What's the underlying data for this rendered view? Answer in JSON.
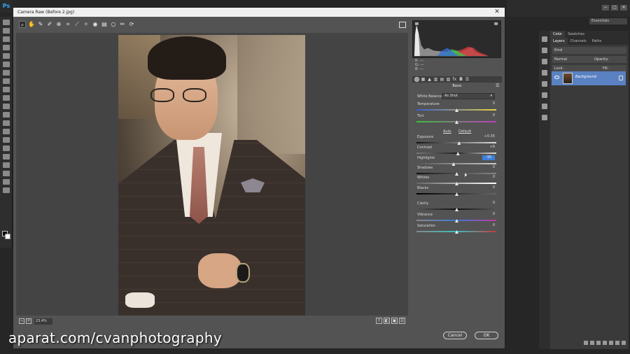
{
  "app": {
    "logo": "Ps",
    "workspace": "Essentials",
    "window_buttons": [
      "−",
      "▢",
      "✕"
    ]
  },
  "dialog": {
    "title": "Camera Raw (Before 2.jpg)",
    "close": "✕"
  },
  "tools": [
    "zoom-icon",
    "hand-icon",
    "white-balance-icon",
    "color-sampler-icon",
    "target-adjust-icon",
    "crop-icon",
    "straighten-icon",
    "spot-removal-icon",
    "red-eye-icon",
    "graduated-filter-icon",
    "radial-filter-icon",
    "brush-icon",
    "rotate-icon"
  ],
  "tool_glyphs": [
    "⌕",
    "✋",
    "✎",
    "✐",
    "⊕",
    "⌗",
    "⟋",
    "✧",
    "◉",
    "▤",
    "○",
    "✏",
    "⟳"
  ],
  "canvas": {
    "zoom": "23.4%",
    "zoom_minus": "−",
    "zoom_plus": "+",
    "view_buttons": [
      "Y",
      "◧",
      "▣",
      "☰"
    ]
  },
  "readout": {
    "r": "R:  ---",
    "g": "G:  ---",
    "b": "B:  ---"
  },
  "panel": {
    "name": "Basic",
    "tab_glyphs": [
      "◎",
      "▦",
      "▲",
      "▥",
      "▤",
      "▧",
      "fx",
      "◘",
      "☰"
    ],
    "white_balance_label": "White Balance:",
    "white_balance_value": "As Shot",
    "auto": "Auto",
    "default": "Default",
    "sliders": [
      {
        "key": "temperature",
        "label": "Temperature",
        "value": "0",
        "position": 0.5,
        "track": "linear-gradient(90deg,#3b5fd0,#e6d23c)"
      },
      {
        "key": "tint",
        "label": "Tint",
        "value": "0",
        "position": 0.5,
        "track": "linear-gradient(90deg,#3cbf3c,#c03cc0)"
      },
      {
        "key": "exposure",
        "label": "Exposure",
        "value": "+0.35",
        "position": 0.53,
        "track": "linear-gradient(90deg,#111,#ddd)"
      },
      {
        "key": "contrast",
        "label": "Contrast",
        "value": "+6",
        "position": 0.515,
        "track": "linear-gradient(90deg,#777,#222,#ddd)"
      },
      {
        "key": "highlights",
        "label": "Highlights",
        "value": "-15",
        "position": 0.46,
        "track": "linear-gradient(90deg,#555,#ccc)",
        "editing": true
      },
      {
        "key": "shadows",
        "label": "Shadows",
        "value": "0",
        "position": 0.5,
        "track": "linear-gradient(90deg,#111,#888)"
      },
      {
        "key": "whites",
        "label": "Whites",
        "value": "0",
        "position": 0.5,
        "track": "linear-gradient(90deg,#666,#fff)"
      },
      {
        "key": "blacks",
        "label": "Blacks",
        "value": "0",
        "position": 0.5,
        "track": "linear-gradient(90deg,#000,#666)"
      },
      {
        "key": "clarity",
        "label": "Clarity",
        "value": "0",
        "position": 0.5,
        "track": "linear-gradient(90deg,#555,#111,#555)"
      },
      {
        "key": "vibrance",
        "label": "Vibrance",
        "value": "0",
        "position": 0.5,
        "track": "linear-gradient(90deg,#888,#3c7bd6,#c03c9c)"
      },
      {
        "key": "saturation",
        "label": "Saturation",
        "value": "0",
        "position": 0.5,
        "track": "linear-gradient(90deg,#888,#3cbfbf,#c03c3c)"
      }
    ]
  },
  "buttons": {
    "cancel": "Cancel",
    "ok": "OK"
  },
  "ps_panel": {
    "tabs_top": [
      "Color",
      "Swatches"
    ],
    "tabs_layers": [
      "Layers",
      "Channels",
      "Paths"
    ],
    "kind": "Kind",
    "blend": "Normal",
    "opacity_label": "Opacity:",
    "lock_label": "Lock:",
    "fill_label": "Fill:",
    "layer_name": "Background"
  },
  "watermark": "aparat.com/cvanphotography"
}
